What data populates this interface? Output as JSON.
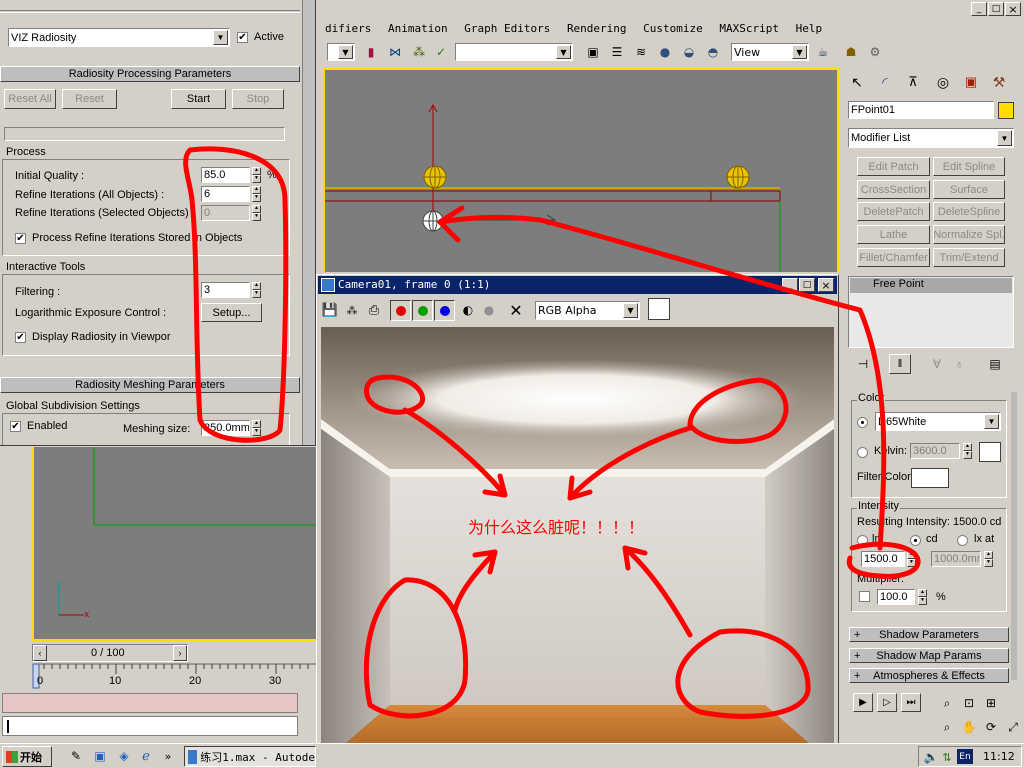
{
  "app": {
    "menu": [
      "difiers",
      "Animation",
      "Graph Editors",
      "Rendering",
      "Customize",
      "MAXScript",
      "Help"
    ],
    "view_label": "View",
    "win_min": "_",
    "win_max": "□",
    "win_close": "×"
  },
  "radiosity": {
    "engine": "VIZ Radiosity",
    "active_label": "Active",
    "processing_rollout": "Radiosity Processing Parameters",
    "buttons": {
      "reset_all": "Reset All",
      "reset": "Reset",
      "start": "Start",
      "stop": "Stop"
    },
    "process_group": "Process",
    "initial_quality_label": "Initial Quality :",
    "initial_quality": "85.0",
    "percent": "%",
    "refine_all_label": "Refine Iterations (All Objects) :",
    "refine_all": "6",
    "refine_sel_label": "Refine Iterations (Selected Objects) :",
    "refine_sel": "0",
    "process_refine_label": "Process Refine Iterations Stored in Objects",
    "interactive_group": "Interactive Tools",
    "filtering_label": "Filtering :",
    "filtering": "3",
    "log_exposure_label": "Logarithmic Exposure Control :",
    "setup_button": "Setup...",
    "display_radiosity_label": "Display Radiosity in Viewpor",
    "meshing_rollout": "Radiosity Meshing Parameters",
    "global_subdiv_group": "Global Subdivision Settings",
    "enabled_label": "Enabled",
    "meshing_size_label": "Meshing size:",
    "meshing_size": "250.0mm"
  },
  "timeline": {
    "frame_counter": "0 / 100",
    "ticks": [
      "0",
      "10",
      "20",
      "30"
    ]
  },
  "viewport2": {
    "axis_y": "y",
    "axis_x": "x"
  },
  "render_window": {
    "title": "Camera01, frame 0 (1:1)",
    "channel": "RGB Alpha",
    "annotation": "为什么这么脏呢！！！！"
  },
  "command_panel": {
    "object_name": "FPoint01",
    "modifier_list": "Modifier List",
    "modifier_buttons": [
      "Edit Patch",
      "Edit Spline",
      "CrossSection",
      "Surface",
      "DeletePatch",
      "DeleteSpline",
      "Lathe",
      "Normalize Spl.",
      "Fillet/Chamfer",
      "Trim/Extend"
    ],
    "stack_item": "Free Point",
    "color_group": "Color",
    "color_preset": "D65White",
    "kelvin_label": "Kelvin:",
    "kelvin": "3600.0",
    "filter_color_label": "Filter Color:",
    "intensity_group": "Intensity",
    "resulting_intensity": "Resulting Intensity: 1500.0 cd",
    "unit_lm": "lm",
    "unit_cd": "cd",
    "unit_lx": "lx at",
    "intensity_value": "1500.0",
    "distance_value": "1000.0mm",
    "multiplier_label": "Multiplier:",
    "multiplier": "100.0",
    "percent": "%",
    "rollouts": [
      "Shadow Parameters",
      "Shadow Map Params",
      "Atmospheres & Effects"
    ]
  },
  "taskbar": {
    "start": "开始",
    "task": "练习1.max - Autode",
    "lang": "En",
    "clock": "11:12"
  },
  "colors": {
    "viewport_bg": "#7d7d7d",
    "annotation_red": "#ff0000",
    "selected_yellow": "#ffdc00",
    "taskbar_blue": "#0a246a"
  }
}
